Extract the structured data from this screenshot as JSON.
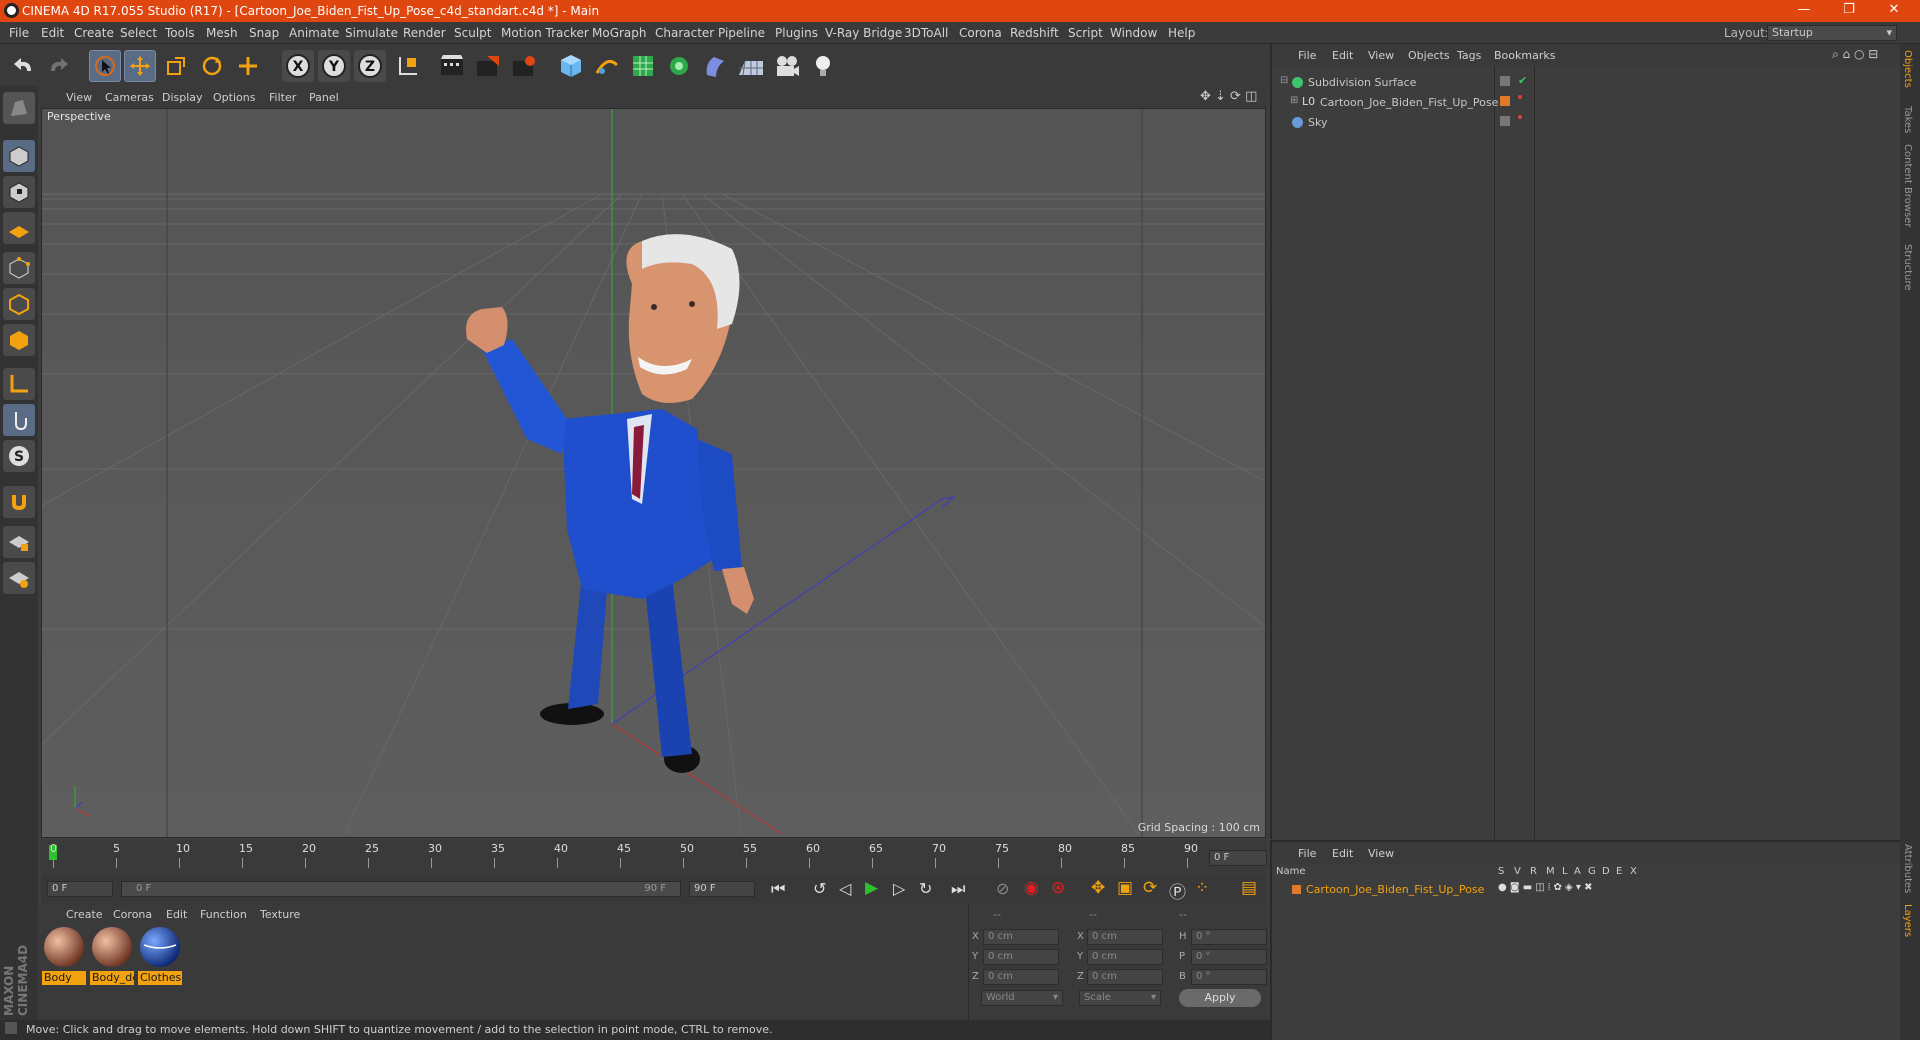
{
  "window": {
    "title": "CINEMA 4D R17.055 Studio (R17) - [Cartoon_Joe_Biden_Fist_Up_Pose_c4d_standart.c4d *] - Main"
  },
  "menubar": {
    "items": [
      "File",
      "Edit",
      "Create",
      "Select",
      "Tools",
      "Mesh",
      "Snap",
      "Animate",
      "Simulate",
      "Render",
      "Sculpt",
      "Motion Tracker",
      "MoGraph",
      "Character",
      "Pipeline",
      "Plugins",
      "V-Ray Bridge",
      "3DToAll",
      "Corona",
      "Redshift",
      "Script",
      "Window",
      "Help"
    ],
    "layout_label": "Layout:",
    "layout_value": "Startup"
  },
  "toolbar": {
    "icons": [
      "undo-icon",
      "redo-icon",
      "select-cursor-icon",
      "move-icon",
      "scale-icon",
      "rotate-icon",
      "move-plus-icon",
      "axis-x-icon",
      "axis-y-icon",
      "axis-z-icon",
      "coordinate-system-icon",
      "render-view-icon",
      "render-picture-viewer-icon",
      "edit-render-settings-icon",
      "cube-icon",
      "bend-pen-icon",
      "subdivision-icon",
      "cloner-icon",
      "deformer-icon",
      "floor-icon",
      "camera-icon",
      "light-icon"
    ],
    "axis": {
      "x": "X",
      "y": "Y",
      "z": "Z"
    }
  },
  "leftbar": {
    "icons": [
      "model-mode-icon",
      "object-icon",
      "texture-icon",
      "workplane-icon",
      "points-icon",
      "edges-icon",
      "polygons-icon",
      "axis-icon",
      "tweak-icon",
      "solo-icon",
      "magnet-icon",
      "grid-lock-icon",
      "snap-icon"
    ]
  },
  "viewport": {
    "menu": [
      "View",
      "Cameras",
      "Display",
      "Options",
      "Filter",
      "Panel"
    ],
    "label": "Perspective",
    "grid_spacing": "Grid Spacing : 100 cm"
  },
  "timeline": {
    "ticks": [
      "0",
      "5",
      "10",
      "15",
      "20",
      "25",
      "30",
      "35",
      "40",
      "45",
      "50",
      "55",
      "60",
      "65",
      "70",
      "75",
      "80",
      "85",
      "90"
    ],
    "current_frame": "0 F",
    "start_field": "0 F",
    "range_start": "0 F",
    "range_end": "90 F",
    "end_field": "90 F"
  },
  "materials": {
    "menu": [
      "Create",
      "Corona",
      "Edit",
      "Function",
      "Texture"
    ],
    "items": [
      {
        "name": "Body",
        "color": "#c87858"
      },
      {
        "name": "Body_de",
        "color": "#c87858"
      },
      {
        "name": "Clothes",
        "color": "#1a4fc4"
      }
    ]
  },
  "coords": {
    "header": [
      "--",
      "--",
      "--"
    ],
    "rows": [
      {
        "a": "X",
        "av": "0 cm",
        "b": "X",
        "bv": "0 cm",
        "c": "H",
        "cv": "0 °"
      },
      {
        "a": "Y",
        "av": "0 cm",
        "b": "Y",
        "bv": "0 cm",
        "c": "P",
        "cv": "0 °"
      },
      {
        "a": "Z",
        "av": "0 cm",
        "b": "Z",
        "bv": "0 cm",
        "c": "B",
        "cv": "0 °"
      }
    ],
    "world": "World",
    "scale": "Scale",
    "apply": "Apply"
  },
  "status": {
    "text": "Move: Click and drag to move elements. Hold down SHIFT to quantize movement / add to the selection in point mode, CTRL to remove."
  },
  "objects": {
    "menu": [
      "File",
      "Edit",
      "View",
      "Objects",
      "Tags",
      "Bookmarks"
    ],
    "items": [
      {
        "name": "Subdivision Surface",
        "color": "#3ec46a"
      },
      {
        "name": "Cartoon_Joe_Biden_Fist_Up_Pose",
        "color": "#e07a2a"
      },
      {
        "name": "Sky",
        "color": "#6a9ad8"
      }
    ]
  },
  "layers": {
    "menu": [
      "File",
      "Edit",
      "View"
    ],
    "columns": [
      "Name",
      "S",
      "V",
      "R",
      "M",
      "L",
      "A",
      "G",
      "D",
      "E",
      "X"
    ],
    "items": [
      {
        "name": "Cartoon_Joe_Biden_Fist_Up_Pose",
        "color": "#e07a2a"
      }
    ]
  },
  "right_tabs": [
    "Objects",
    "Takes",
    "Content Browser",
    "Structure",
    "Attributes",
    "Layers"
  ]
}
